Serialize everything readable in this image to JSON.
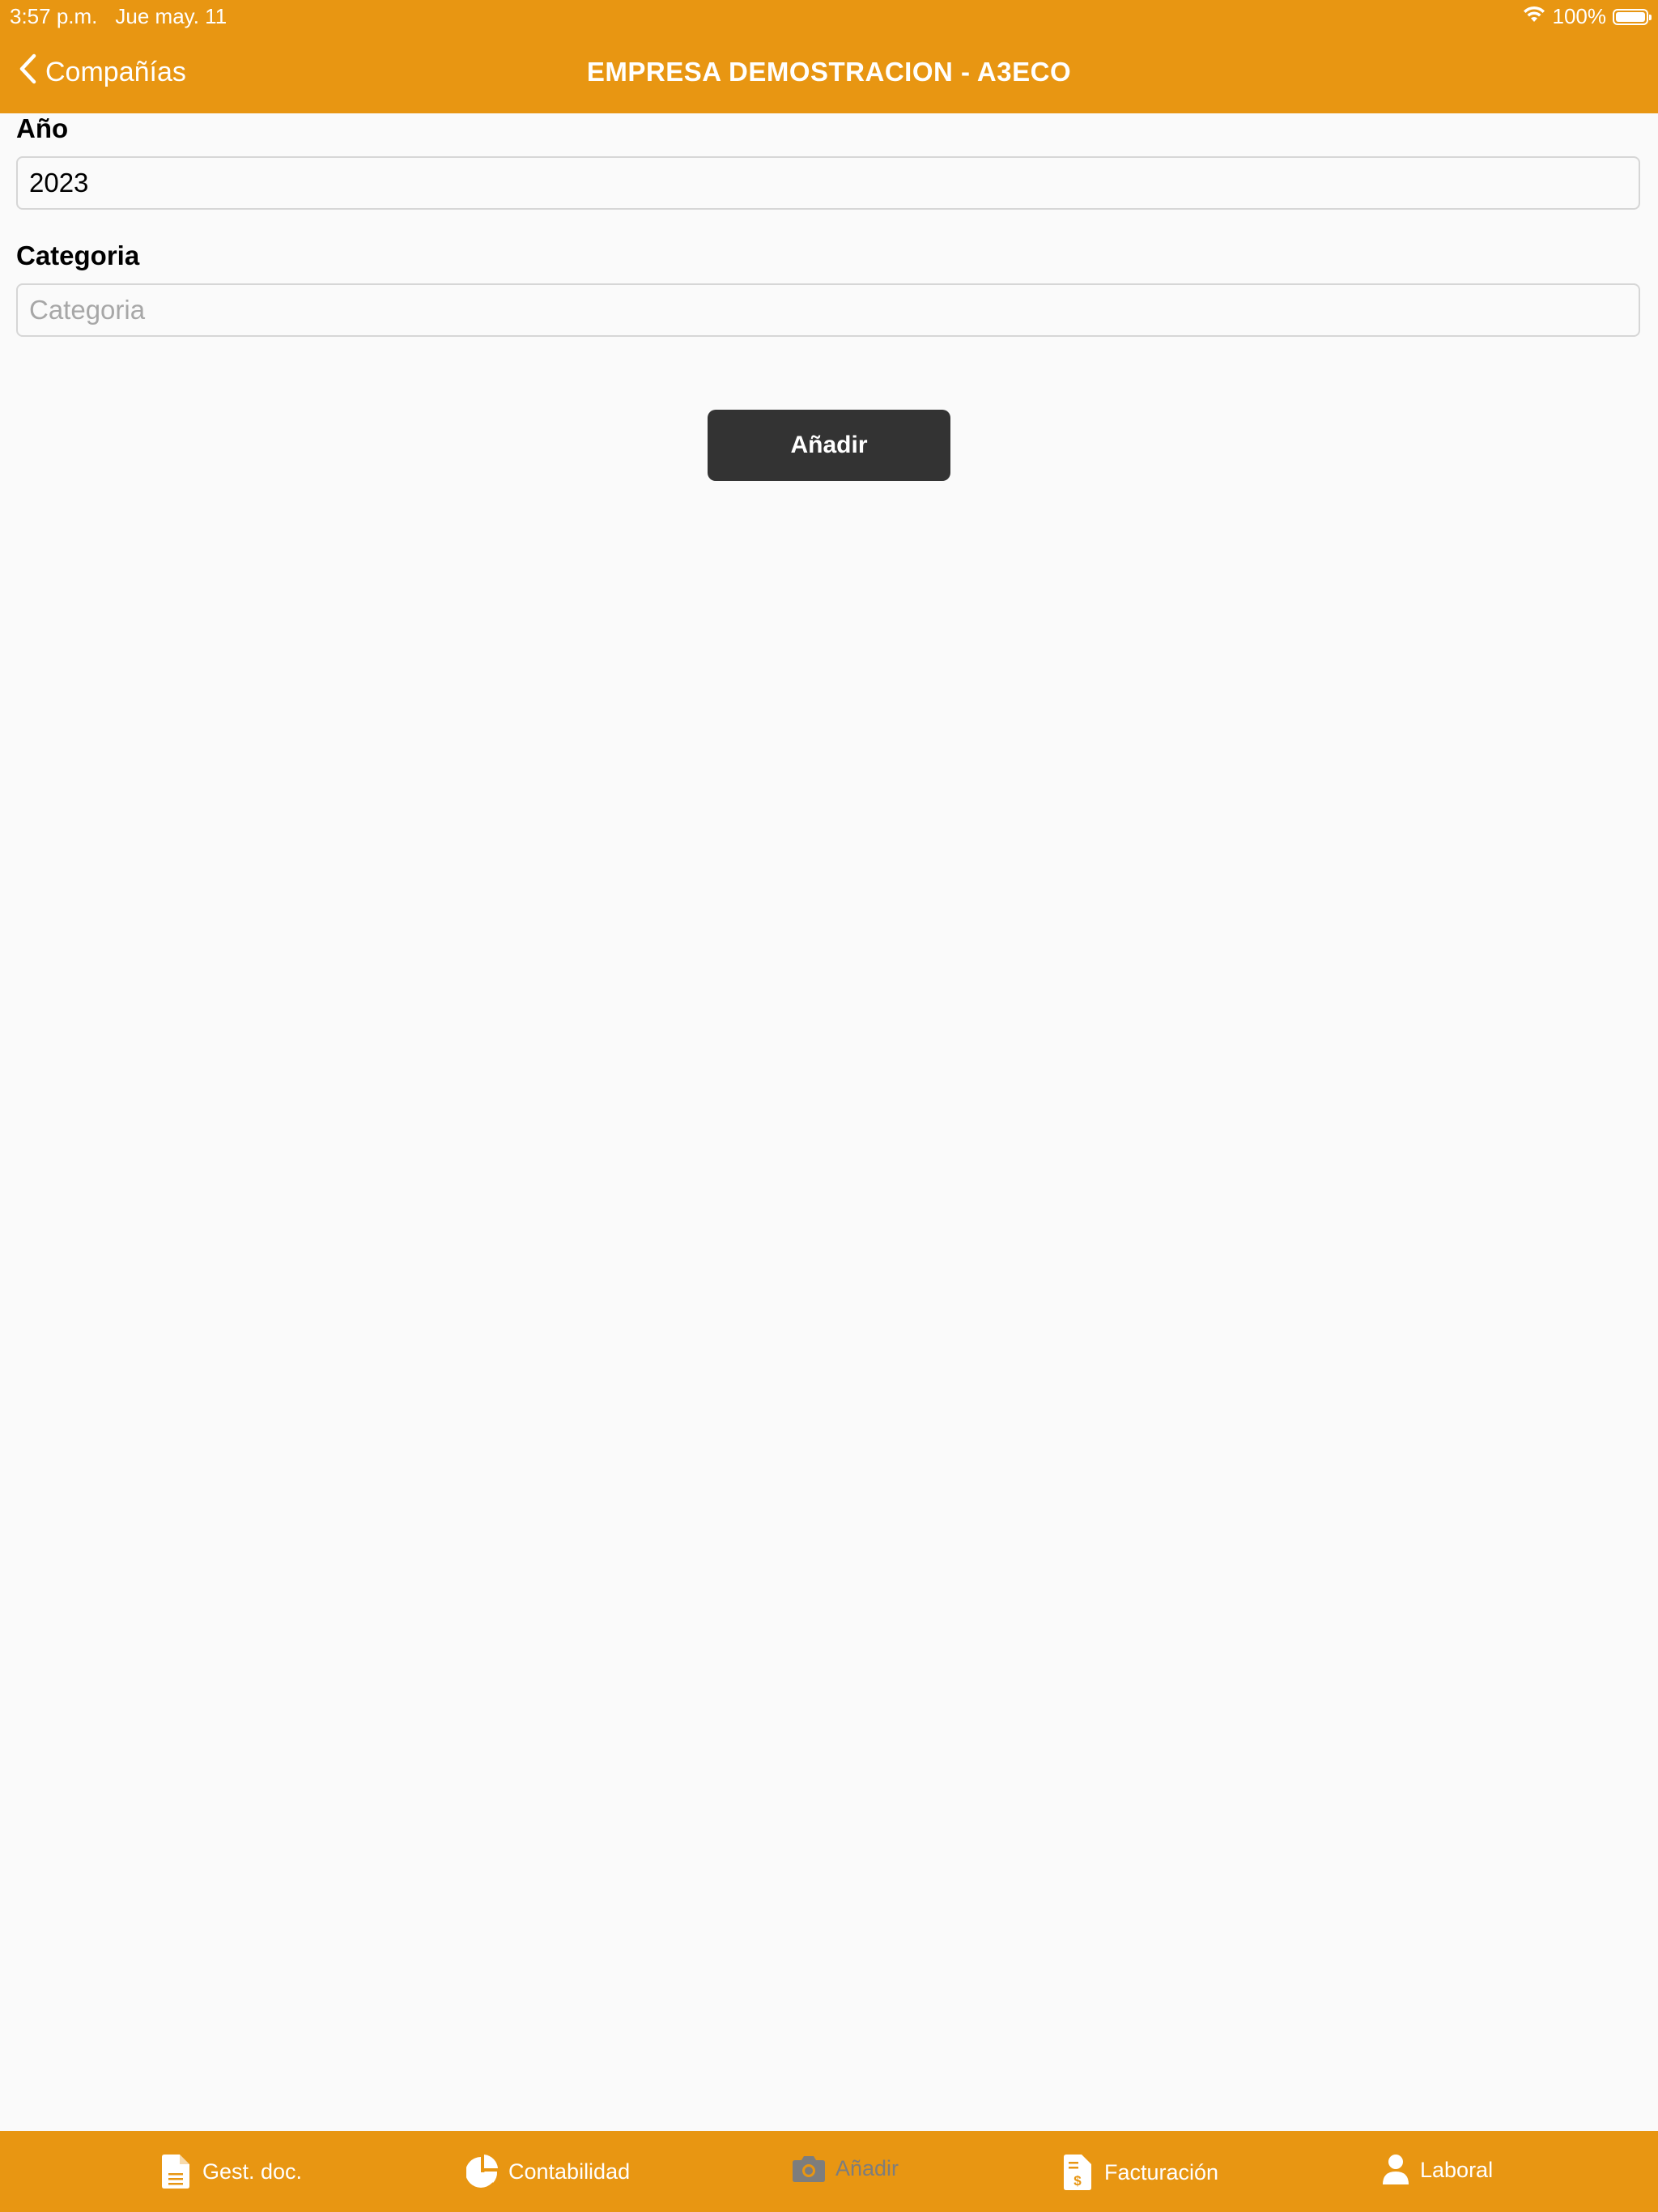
{
  "status_bar": {
    "time": "3:57 p.m.",
    "date": "Jue may. 11",
    "battery": "100%"
  },
  "nav": {
    "back_label": "Compañías",
    "title": "EMPRESA DEMOSTRACION - A3ECO"
  },
  "form": {
    "year_label": "Año",
    "year_value": "2023",
    "category_label": "Categoria",
    "category_placeholder": "Categoria",
    "add_label": "Añadir"
  },
  "tabs": [
    {
      "label": "Gest. doc.",
      "icon": "document-icon"
    },
    {
      "label": "Contabilidad",
      "icon": "pie-chart-icon"
    },
    {
      "label": "Añadir",
      "icon": "camera-icon"
    },
    {
      "label": "Facturación",
      "icon": "invoice-icon"
    },
    {
      "label": "Laboral",
      "icon": "person-icon"
    }
  ],
  "colors": {
    "brand": "#e89612",
    "button": "#333333",
    "inactive_tab": "#7d7d7d"
  }
}
